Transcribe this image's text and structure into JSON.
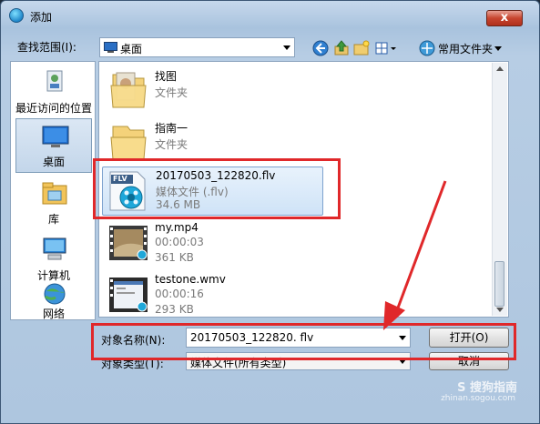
{
  "window": {
    "title": "添加",
    "close_glyph": "x"
  },
  "toolbar": {
    "look_in_label": "查找范围(I):",
    "location": "桌面",
    "favorites_label": "常用文件夹"
  },
  "sidebar": {
    "items": [
      {
        "label": "最近访问的位置",
        "icon": "recent-places-icon"
      },
      {
        "label": "桌面",
        "icon": "desktop-icon",
        "selected": true
      },
      {
        "label": "库",
        "icon": "libraries-icon"
      },
      {
        "label": "计算机",
        "icon": "computer-icon"
      },
      {
        "label": "网络",
        "icon": "network-icon"
      }
    ]
  },
  "files": [
    {
      "name": "找图",
      "type": "文件夹",
      "size": "",
      "kind": "folder"
    },
    {
      "name": "指南一",
      "type": "文件夹",
      "size": "",
      "kind": "folder"
    },
    {
      "name": "20170503_122820.flv",
      "type": "媒体文件 (.flv)",
      "size": "34.6 MB",
      "kind": "flv",
      "badge": "FLV",
      "selected": true
    },
    {
      "name": "my.mp4",
      "type": "00:00:03",
      "size": "361 KB",
      "kind": "video"
    },
    {
      "name": "testone.wmv",
      "type": "00:00:16",
      "size": "293 KB",
      "kind": "video"
    }
  ],
  "form": {
    "name_label": "对象名称(N):",
    "name_value": "20170503_122820. flv",
    "type_label": "对象类型(T):",
    "type_value": "媒体文件(所有类型)",
    "open_button": "打开(O)",
    "cancel_button": "取消"
  },
  "watermark": {
    "text": "S 搜狗指南",
    "url": "zhinan.sogou.com"
  },
  "colors": {
    "highlight": "#e0282a",
    "selection": "#cfe3f7"
  }
}
